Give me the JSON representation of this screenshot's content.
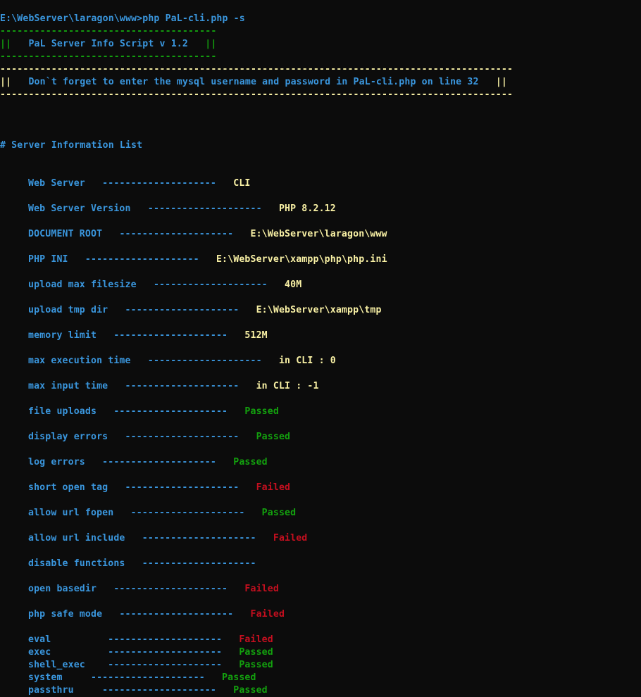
{
  "terminal": {
    "prompt_line": "E:\\WebServer\\laragon\\www>php PaL-cli.php -s",
    "banner": {
      "border": "--------------------------------------",
      "title": "||   PaL Server Info Script v 1.2   ||"
    },
    "notice": {
      "border": "------------------------------------------------------------------------------------------",
      "left_bars": "||",
      "text": "   Don`t forget to enter the mysql username and password in PaL-cli.php on line 32   ",
      "right_bars": "||"
    },
    "section_heading": "# Server Information List",
    "separator": "--------------------",
    "info_rows": [
      {
        "label": "Web Server",
        "value": "CLI",
        "status": "info"
      },
      {
        "label": "Web Server Version",
        "value": "PHP 8.2.12",
        "status": "info"
      },
      {
        "label": "DOCUMENT ROOT",
        "value": "E:\\WebServer\\laragon\\www",
        "status": "info"
      },
      {
        "label": "PHP INI",
        "value": "E:\\WebServer\\xampp\\php\\php.ini",
        "status": "info"
      },
      {
        "label": "upload max filesize",
        "value": "40M",
        "status": "info"
      },
      {
        "label": "upload tmp dir",
        "value": "E:\\WebServer\\xampp\\tmp",
        "status": "info"
      },
      {
        "label": "memory limit",
        "value": "512M",
        "status": "info"
      },
      {
        "label": "max execution time",
        "value": "in CLI : 0",
        "status": "info"
      },
      {
        "label": "max input time",
        "value": "in CLI : -1",
        "status": "info"
      },
      {
        "label": "file uploads",
        "value": "Passed",
        "status": "passed"
      },
      {
        "label": "display errors",
        "value": "Passed",
        "status": "passed"
      },
      {
        "label": "log errors",
        "value": "Passed",
        "status": "passed"
      },
      {
        "label": "short open tag",
        "value": "Failed",
        "status": "failed"
      },
      {
        "label": "allow url fopen",
        "value": "Passed",
        "status": "passed"
      },
      {
        "label": "allow url include",
        "value": "Failed",
        "status": "failed"
      },
      {
        "label": "disable functions",
        "value": "",
        "status": "info"
      },
      {
        "label": "open basedir",
        "value": "Failed",
        "status": "failed"
      },
      {
        "label": "php safe mode",
        "value": "Failed",
        "status": "failed"
      }
    ],
    "function_rows": [
      {
        "label": "eval       ",
        "value": "Failed",
        "status": "failed"
      },
      {
        "label": "exec       ",
        "value": "Passed",
        "status": "passed"
      },
      {
        "label": "shell_exec ",
        "value": "Passed",
        "status": "passed"
      },
      {
        "label": "system  ",
        "value": "Passed",
        "status": "passed"
      },
      {
        "label": "passthru  ",
        "value": "Passed",
        "status": "passed"
      }
    ]
  },
  "colors": {
    "background": "#0c0c0c",
    "label": "#3a96dd",
    "value": "#f9f1a5",
    "passed": "#13a10e",
    "failed": "#c50f1f"
  }
}
